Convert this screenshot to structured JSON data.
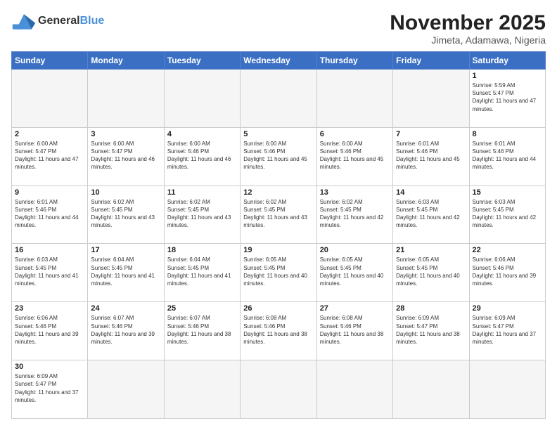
{
  "header": {
    "logo_general": "General",
    "logo_blue": "Blue",
    "month_year": "November 2025",
    "location": "Jimeta, Adamawa, Nigeria"
  },
  "weekdays": [
    "Sunday",
    "Monday",
    "Tuesday",
    "Wednesday",
    "Thursday",
    "Friday",
    "Saturday"
  ],
  "weeks": [
    [
      {
        "day": "",
        "info": ""
      },
      {
        "day": "",
        "info": ""
      },
      {
        "day": "",
        "info": ""
      },
      {
        "day": "",
        "info": ""
      },
      {
        "day": "",
        "info": ""
      },
      {
        "day": "",
        "info": ""
      },
      {
        "day": "1",
        "info": "Sunrise: 5:59 AM\nSunset: 5:47 PM\nDaylight: 11 hours and 47 minutes."
      }
    ],
    [
      {
        "day": "2",
        "info": "Sunrise: 6:00 AM\nSunset: 5:47 PM\nDaylight: 11 hours and 47 minutes."
      },
      {
        "day": "3",
        "info": "Sunrise: 6:00 AM\nSunset: 5:47 PM\nDaylight: 11 hours and 46 minutes."
      },
      {
        "day": "4",
        "info": "Sunrise: 6:00 AM\nSunset: 5:46 PM\nDaylight: 11 hours and 46 minutes."
      },
      {
        "day": "5",
        "info": "Sunrise: 6:00 AM\nSunset: 5:46 PM\nDaylight: 11 hours and 45 minutes."
      },
      {
        "day": "6",
        "info": "Sunrise: 6:00 AM\nSunset: 5:46 PM\nDaylight: 11 hours and 45 minutes."
      },
      {
        "day": "7",
        "info": "Sunrise: 6:01 AM\nSunset: 5:46 PM\nDaylight: 11 hours and 45 minutes."
      },
      {
        "day": "8",
        "info": "Sunrise: 6:01 AM\nSunset: 5:46 PM\nDaylight: 11 hours and 44 minutes."
      }
    ],
    [
      {
        "day": "9",
        "info": "Sunrise: 6:01 AM\nSunset: 5:46 PM\nDaylight: 11 hours and 44 minutes."
      },
      {
        "day": "10",
        "info": "Sunrise: 6:02 AM\nSunset: 5:45 PM\nDaylight: 11 hours and 43 minutes."
      },
      {
        "day": "11",
        "info": "Sunrise: 6:02 AM\nSunset: 5:45 PM\nDaylight: 11 hours and 43 minutes."
      },
      {
        "day": "12",
        "info": "Sunrise: 6:02 AM\nSunset: 5:45 PM\nDaylight: 11 hours and 43 minutes."
      },
      {
        "day": "13",
        "info": "Sunrise: 6:02 AM\nSunset: 5:45 PM\nDaylight: 11 hours and 42 minutes."
      },
      {
        "day": "14",
        "info": "Sunrise: 6:03 AM\nSunset: 5:45 PM\nDaylight: 11 hours and 42 minutes."
      },
      {
        "day": "15",
        "info": "Sunrise: 6:03 AM\nSunset: 5:45 PM\nDaylight: 11 hours and 42 minutes."
      }
    ],
    [
      {
        "day": "16",
        "info": "Sunrise: 6:03 AM\nSunset: 5:45 PM\nDaylight: 11 hours and 41 minutes."
      },
      {
        "day": "17",
        "info": "Sunrise: 6:04 AM\nSunset: 5:45 PM\nDaylight: 11 hours and 41 minutes."
      },
      {
        "day": "18",
        "info": "Sunrise: 6:04 AM\nSunset: 5:45 PM\nDaylight: 11 hours and 41 minutes."
      },
      {
        "day": "19",
        "info": "Sunrise: 6:05 AM\nSunset: 5:45 PM\nDaylight: 11 hours and 40 minutes."
      },
      {
        "day": "20",
        "info": "Sunrise: 6:05 AM\nSunset: 5:45 PM\nDaylight: 11 hours and 40 minutes."
      },
      {
        "day": "21",
        "info": "Sunrise: 6:05 AM\nSunset: 5:45 PM\nDaylight: 11 hours and 40 minutes."
      },
      {
        "day": "22",
        "info": "Sunrise: 6:06 AM\nSunset: 5:46 PM\nDaylight: 11 hours and 39 minutes."
      }
    ],
    [
      {
        "day": "23",
        "info": "Sunrise: 6:06 AM\nSunset: 5:46 PM\nDaylight: 11 hours and 39 minutes."
      },
      {
        "day": "24",
        "info": "Sunrise: 6:07 AM\nSunset: 5:46 PM\nDaylight: 11 hours and 39 minutes."
      },
      {
        "day": "25",
        "info": "Sunrise: 6:07 AM\nSunset: 5:46 PM\nDaylight: 11 hours and 38 minutes."
      },
      {
        "day": "26",
        "info": "Sunrise: 6:08 AM\nSunset: 5:46 PM\nDaylight: 11 hours and 38 minutes."
      },
      {
        "day": "27",
        "info": "Sunrise: 6:08 AM\nSunset: 5:46 PM\nDaylight: 11 hours and 38 minutes."
      },
      {
        "day": "28",
        "info": "Sunrise: 6:09 AM\nSunset: 5:47 PM\nDaylight: 11 hours and 38 minutes."
      },
      {
        "day": "29",
        "info": "Sunrise: 6:09 AM\nSunset: 5:47 PM\nDaylight: 11 hours and 37 minutes."
      }
    ],
    [
      {
        "day": "30",
        "info": "Sunrise: 6:09 AM\nSunset: 5:47 PM\nDaylight: 11 hours and 37 minutes."
      },
      {
        "day": "",
        "info": ""
      },
      {
        "day": "",
        "info": ""
      },
      {
        "day": "",
        "info": ""
      },
      {
        "day": "",
        "info": ""
      },
      {
        "day": "",
        "info": ""
      },
      {
        "day": "",
        "info": ""
      }
    ]
  ]
}
